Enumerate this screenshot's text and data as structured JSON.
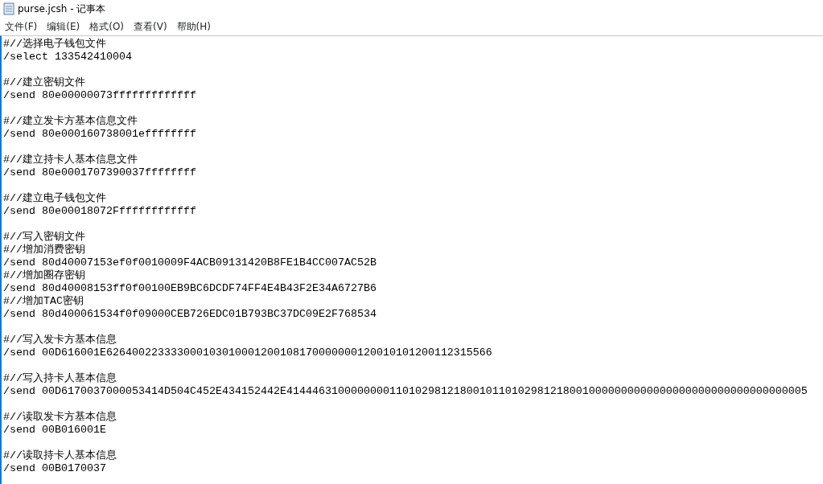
{
  "window": {
    "title": "purse.jcsh - 记事本"
  },
  "menu": [
    "文件(F)",
    "编辑(E)",
    "格式(O)",
    "查看(V)",
    "帮助(H)"
  ],
  "document": {
    "blocks": [
      [
        "#//选择电子钱包文件",
        "/select 133542410004"
      ],
      [
        "#//建立密钥文件",
        "/send 80e00000073fffffffffffff"
      ],
      [
        "#//建立发卡方基本信息文件",
        "/send 80e000160738001effffffff"
      ],
      [
        "#//建立持卡人基本信息文件",
        "/send 80e0001707390037ffffffff"
      ],
      [
        "#//建立电子钱包文件",
        "/send 80e00018072Fffffffffffff"
      ],
      [
        "#//写入密钥文件",
        "#//增加消费密钥",
        "/send 80d40007153ef0f0010009F4ACB09131420B8FE1B4CC007AC52B",
        "#//增加圈存密钥",
        "/send 80d40008153ff0f00100EB9BC6DCDF74FF4E4B43F2E34A6727B6",
        "#//增加TAC密钥",
        "/send 80d400061534f0f09000CEB726EDC01B793BC37DC09E2F768534"
      ],
      [
        "#//写入发卡方基本信息",
        "/send 00D616001E626400223333000103010001200108170000000120010101200112315566"
      ],
      [
        "#//写入持卡人基本信息",
        "/send 00D6170037000053414D504C452E434152442E414446310000000011010298121800101101029812180010000000000000000000000000000000005"
      ],
      [
        "#//读取发卡方基本信息",
        "/send 00B016001E"
      ],
      [
        "#//读取持卡人基本信息",
        "/send 00B0170037"
      ]
    ]
  }
}
